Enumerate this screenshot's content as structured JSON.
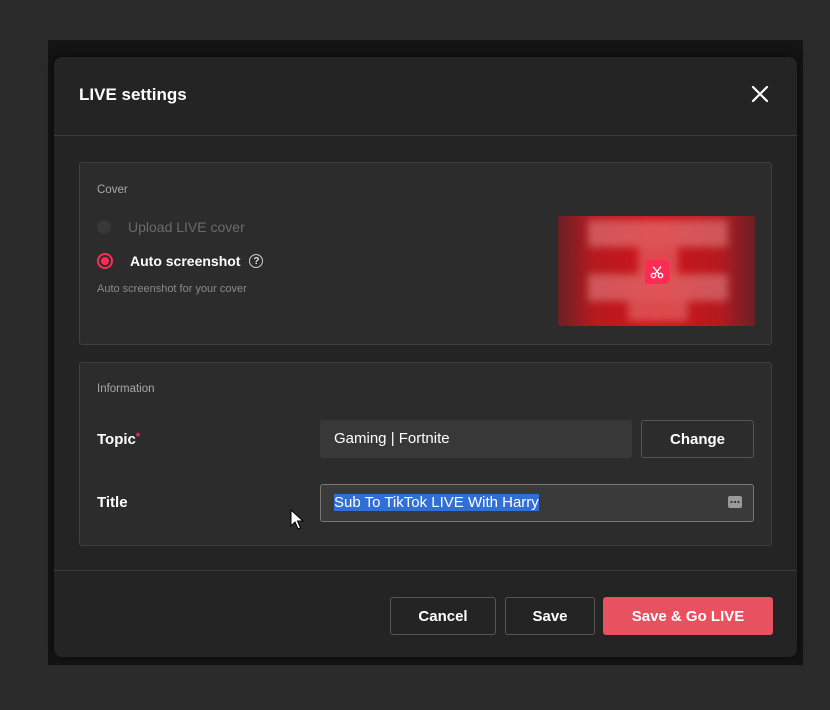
{
  "dialog": {
    "title": "LIVE settings",
    "close_icon": "close-icon"
  },
  "cover": {
    "section_label": "Cover",
    "options": [
      {
        "label": "Upload LIVE cover",
        "selected": false,
        "disabled": true
      },
      {
        "label": "Auto screenshot",
        "selected": true
      }
    ],
    "help_icon": "question-circle-icon",
    "hint": "Auto screenshot for your cover",
    "thumbnail_edit_icon": "scissors-icon"
  },
  "information": {
    "section_label": "Information",
    "topic": {
      "label": "Topic",
      "required_mark": "*",
      "value": "Gaming | Fortnite",
      "change_label": "Change"
    },
    "title": {
      "label": "Title",
      "value": "Sub To TikTok LIVE With Harry",
      "selected": true,
      "trailing_icon": "keyboard-icon"
    }
  },
  "footer": {
    "cancel_label": "Cancel",
    "save_label": "Save",
    "save_go_live_label": "Save & Go LIVE"
  },
  "colors": {
    "accent": "#fe2c55",
    "primary_button": "#e8515f",
    "dialog_bg": "#242424",
    "section_bg": "#2c2c2c",
    "selection": "#2f6fd6"
  }
}
